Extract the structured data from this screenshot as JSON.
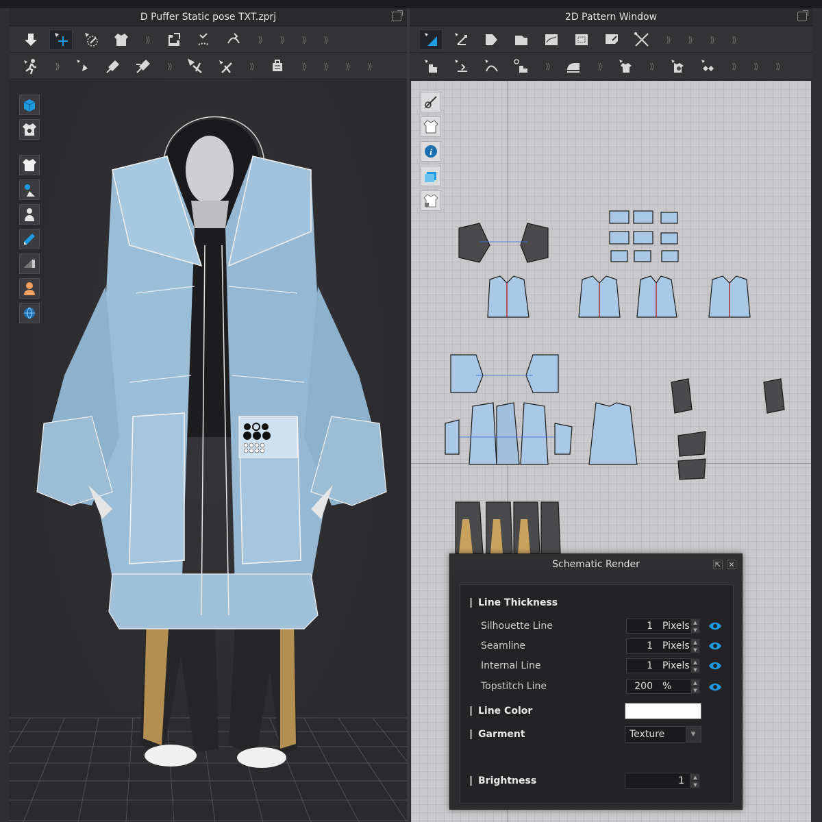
{
  "window_3d": {
    "title": "D Puffer Static pose TXT.zprj",
    "toolbar_row1_icons": [
      "simulate-icon",
      "select-move-icon",
      "select-mesh-icon",
      "garment-icon",
      "fold-arrange-icon",
      "tack-icon",
      "tack-curve-icon"
    ],
    "toolbar_row2_icons": [
      "avatar-walk-icon",
      "pin-icon",
      "pin-box-icon",
      "pin-line-icon",
      "measure-icon",
      "tape-icon",
      "fabric-icon"
    ],
    "side_tools": [
      "fabric-view-icon",
      "texture-icon",
      "garment-shaded-icon",
      "avatar-visibility-icon",
      "avatar-icon",
      "render-icon",
      "light-icon",
      "skin-icon",
      "environment-icon"
    ]
  },
  "window_2d": {
    "title": "2D Pattern Window",
    "toolbar_row1_icons": [
      "transform-pattern-icon",
      "edit-point-icon",
      "polygon-icon",
      "rectangle-icon",
      "ellipse-icon",
      "internal-polygon-icon",
      "dart-icon",
      "cut-icon"
    ],
    "toolbar_row2_icons": [
      "segment-sewing-icon",
      "free-sewing-icon",
      "sewing-curve-icon",
      "edit-sewing-icon",
      "iron-icon",
      "shirt-icon",
      "button-icon",
      "zipper-icon"
    ],
    "side_tools": [
      "pattern-edit-icon",
      "pattern-shirt-icon",
      "info-icon",
      "fabric-layer-icon",
      "lock-shirt-icon"
    ]
  },
  "dialog": {
    "title": "Schematic Render",
    "line_thickness_label": "Line Thickness",
    "rows": [
      {
        "label": "Silhouette Line",
        "value": "1",
        "unit": "Pixels"
      },
      {
        "label": "Seamline",
        "value": "1",
        "unit": "Pixels"
      },
      {
        "label": "Internal Line",
        "value": "1",
        "unit": "Pixels"
      },
      {
        "label": "Topstitch Line",
        "value": "200",
        "unit": "%"
      }
    ],
    "line_color_label": "Line Color",
    "line_color_value": "#ffffff",
    "garment_label": "Garment",
    "garment_value": "Texture",
    "brightness_label": "Brightness",
    "brightness_value": "1"
  },
  "colors": {
    "accent": "#1e9be0",
    "garment_blue": "#9bbdd6",
    "pattern_blue": "#a9c8e6"
  }
}
